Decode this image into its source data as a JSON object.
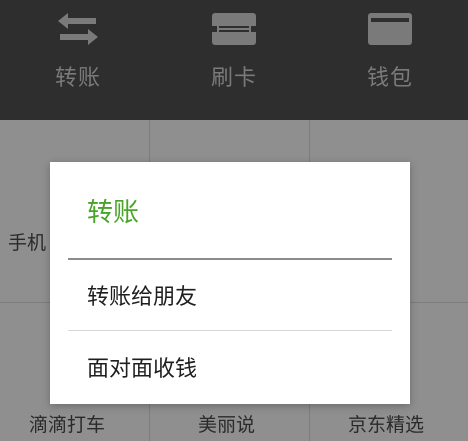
{
  "top_bar": {
    "items": [
      {
        "label": "转账",
        "icon": "transfer-arrows-icon"
      },
      {
        "label": "刷卡",
        "icon": "card-swipe-icon"
      },
      {
        "label": "钱包",
        "icon": "wallet-icon"
      }
    ]
  },
  "grid": {
    "items": [
      {
        "label": "手机"
      },
      {
        "label": "滴滴打车"
      },
      {
        "label": "美丽说"
      },
      {
        "label": "京东精选"
      }
    ]
  },
  "dialog": {
    "title": "转账",
    "options": [
      {
        "label": "转账给朋友"
      },
      {
        "label": "面对面收钱"
      }
    ]
  },
  "colors": {
    "top_bar_bg": "#2e2e2e",
    "accent_green": "#4aa42a",
    "dim_overlay": "#8f8f8f"
  }
}
